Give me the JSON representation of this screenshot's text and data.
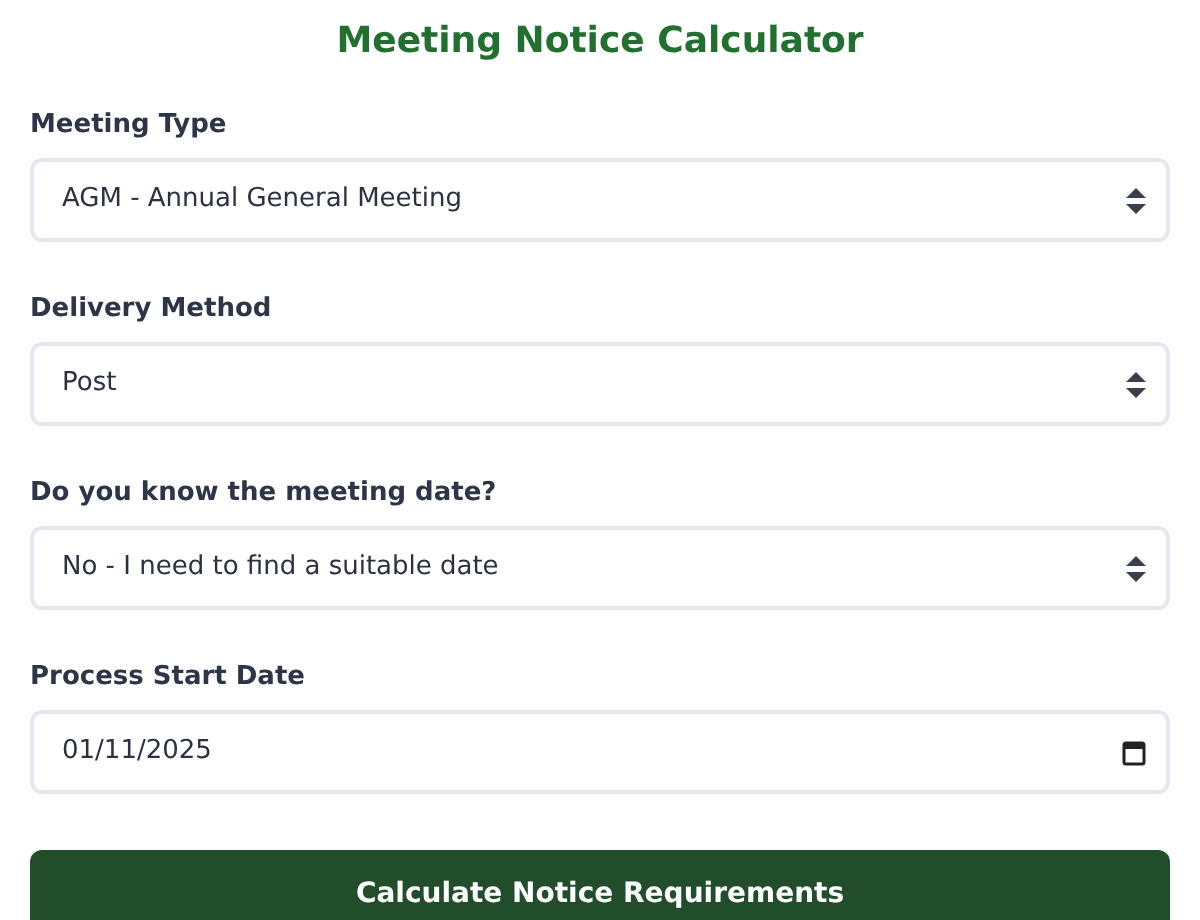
{
  "title": "Meeting Notice Calculator",
  "fields": [
    {
      "label": "Meeting Type",
      "kind": "select",
      "value": "AGM - Annual General Meeting"
    },
    {
      "label": "Delivery Method",
      "kind": "select",
      "value": "Post"
    },
    {
      "label": "Do you know the meeting date?",
      "kind": "select",
      "value": "No - I need to find a suitable date"
    },
    {
      "label": "Process Start Date",
      "kind": "date",
      "value": "01/11/2025"
    }
  ],
  "button": "Calculate Notice Requirements"
}
